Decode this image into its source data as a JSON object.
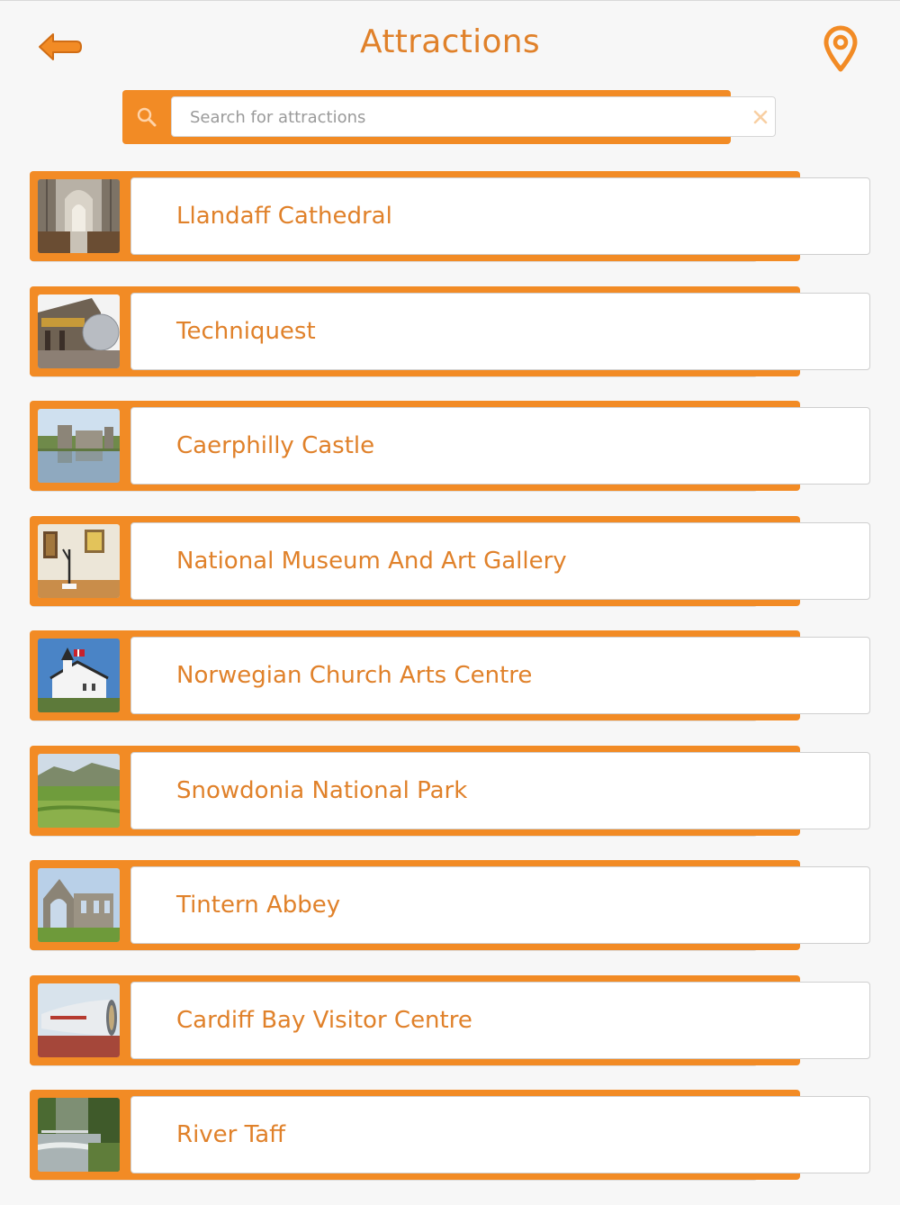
{
  "header": {
    "title": "Attractions",
    "back_icon": "back-arrow-icon",
    "location_icon": "map-pin-icon"
  },
  "search": {
    "placeholder": "Search for attractions",
    "value": "",
    "icon": "search-icon",
    "clear_icon": "close-icon"
  },
  "attractions": [
    {
      "name": "Llandaff Cathedral",
      "image": "cathedral-interior"
    },
    {
      "name": "Techniquest",
      "image": "science-centre-building"
    },
    {
      "name": "Caerphilly Castle",
      "image": "castle-by-water"
    },
    {
      "name": "National Museum And Art Gallery",
      "image": "gallery-room"
    },
    {
      "name": "Norwegian Church Arts Centre",
      "image": "white-church"
    },
    {
      "name": "Snowdonia National Park",
      "image": "green-valley"
    },
    {
      "name": "Tintern Abbey",
      "image": "abbey-ruins"
    },
    {
      "name": "Cardiff Bay Visitor Centre",
      "image": "tube-building"
    },
    {
      "name": "River Taff",
      "image": "river-weir"
    }
  ],
  "colors": {
    "accent": "#f28b25",
    "title_text": "#e0812a",
    "background": "#f7f7f7"
  }
}
